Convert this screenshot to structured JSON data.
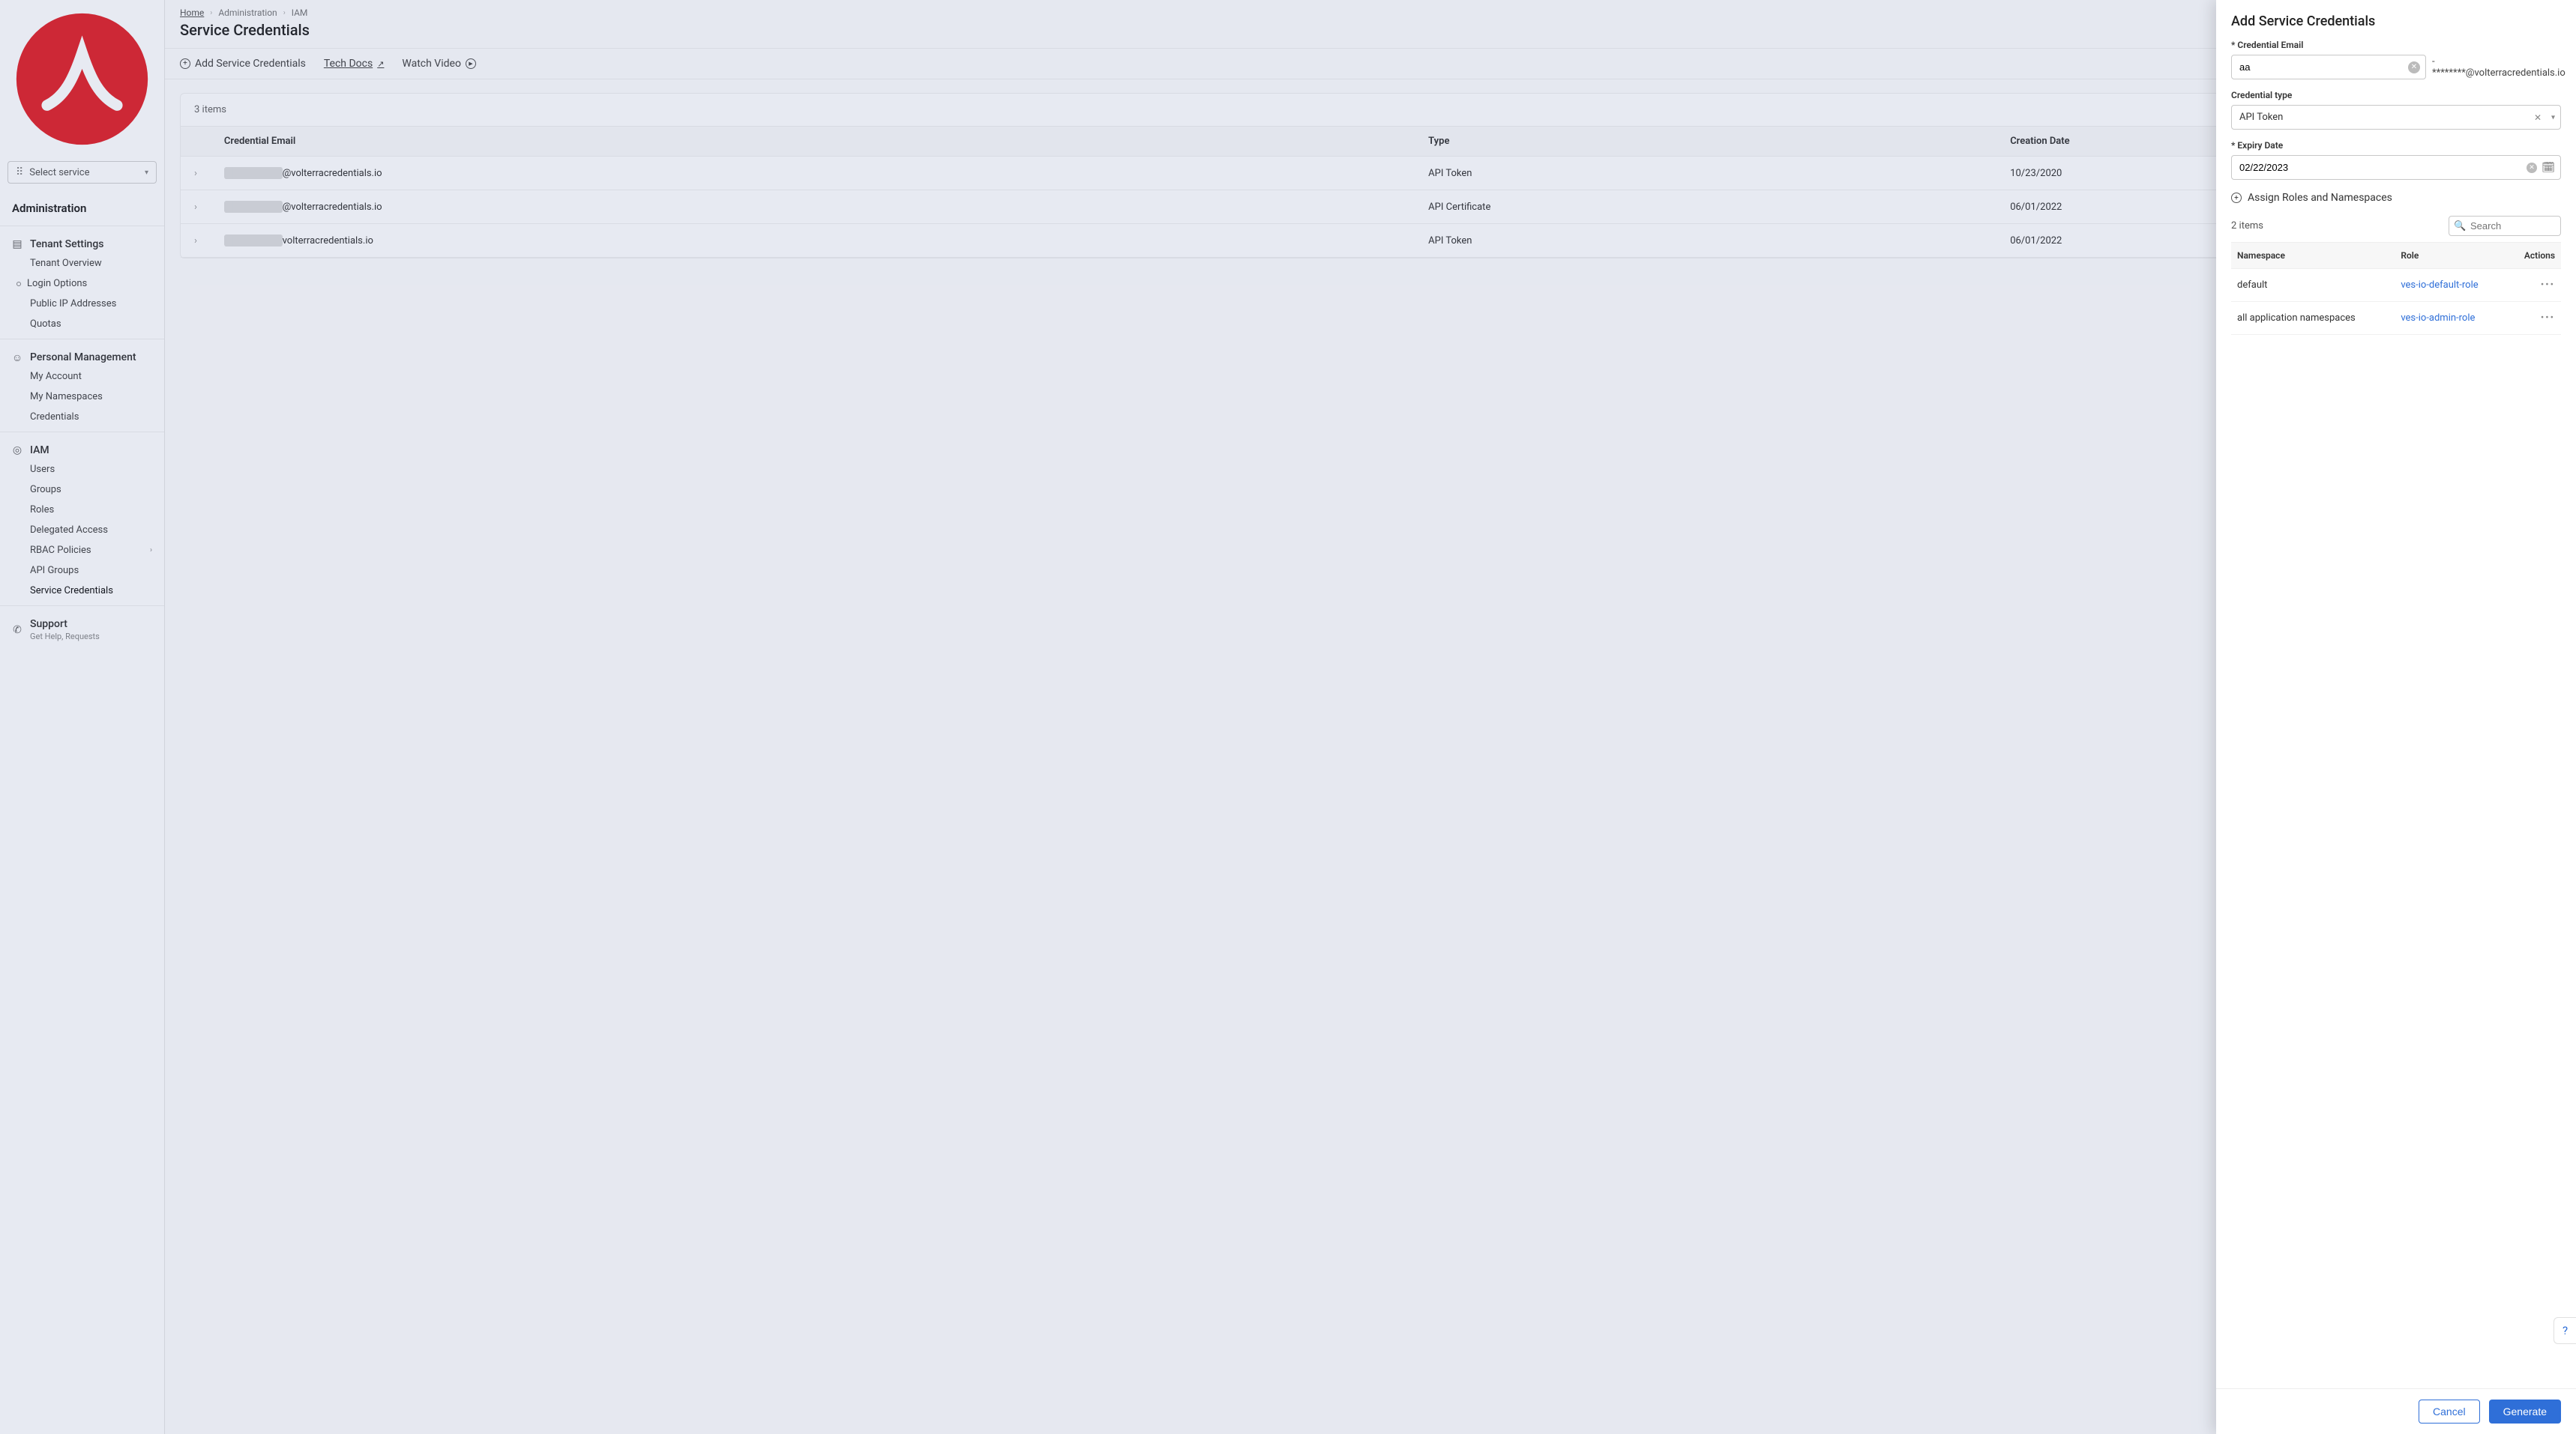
{
  "sidebar": {
    "service_select_label": "Select service",
    "admin_title": "Administration",
    "groups": [
      {
        "title": "Tenant Settings",
        "icon": "building-icon",
        "items": [
          {
            "label": "Tenant Overview"
          },
          {
            "label": "Login Options",
            "dot": true
          },
          {
            "label": "Public IP Addresses"
          },
          {
            "label": "Quotas"
          }
        ]
      },
      {
        "title": "Personal Management",
        "icon": "user-icon",
        "items": [
          {
            "label": "My Account"
          },
          {
            "label": "My Namespaces"
          },
          {
            "label": "Credentials"
          }
        ]
      },
      {
        "title": "IAM",
        "icon": "shield-icon",
        "items": [
          {
            "label": "Users"
          },
          {
            "label": "Groups"
          },
          {
            "label": "Roles"
          },
          {
            "label": "Delegated Access"
          },
          {
            "label": "RBAC Policies",
            "chev": true
          },
          {
            "label": "API Groups"
          },
          {
            "label": "Service Credentials",
            "sel": true
          }
        ]
      },
      {
        "title": "Support",
        "icon": "support-icon",
        "subtitle": "Get Help, Requests",
        "items": []
      }
    ]
  },
  "breadcrumbs": [
    {
      "label": "Home",
      "link": true
    },
    {
      "label": "Administration"
    },
    {
      "label": "IAM"
    }
  ],
  "page_title": "Service Credentials",
  "actions": {
    "add": "Add Service Credentials",
    "docs": "Tech Docs",
    "video": "Watch Video"
  },
  "table": {
    "count_label": "3 items",
    "headers": {
      "email": "Credential Email",
      "type": "Type",
      "date": "Creation Date"
    },
    "rows": [
      {
        "email_suffix": "@volterracredentials.io",
        "type": "API Token",
        "date": "10/23/2020"
      },
      {
        "email_suffix": "@volterracredentials.io",
        "type": "API Certificate",
        "date": "06/01/2022"
      },
      {
        "email_suffix": "volterracredentials.io",
        "type": "API Token",
        "date": "06/01/2022"
      }
    ]
  },
  "panel": {
    "title": "Add Service Credentials",
    "labels": {
      "email": "Credential Email",
      "type": "Credential type",
      "expiry": "Expiry Date",
      "assign": "Assign Roles and Namespaces"
    },
    "email_value": "aa",
    "email_suffix": "-********@volterracredentials.io",
    "type_value": "API Token",
    "expiry_value": "02/22/2023",
    "roles": {
      "count_label": "2 items",
      "search_placeholder": "Search",
      "headers": {
        "ns": "Namespace",
        "role": "Role",
        "actions": "Actions"
      },
      "rows": [
        {
          "ns": "default",
          "role": "ves-io-default-role"
        },
        {
          "ns": "all application namespaces",
          "role": "ves-io-admin-role"
        }
      ]
    },
    "buttons": {
      "cancel": "Cancel",
      "generate": "Generate"
    }
  }
}
